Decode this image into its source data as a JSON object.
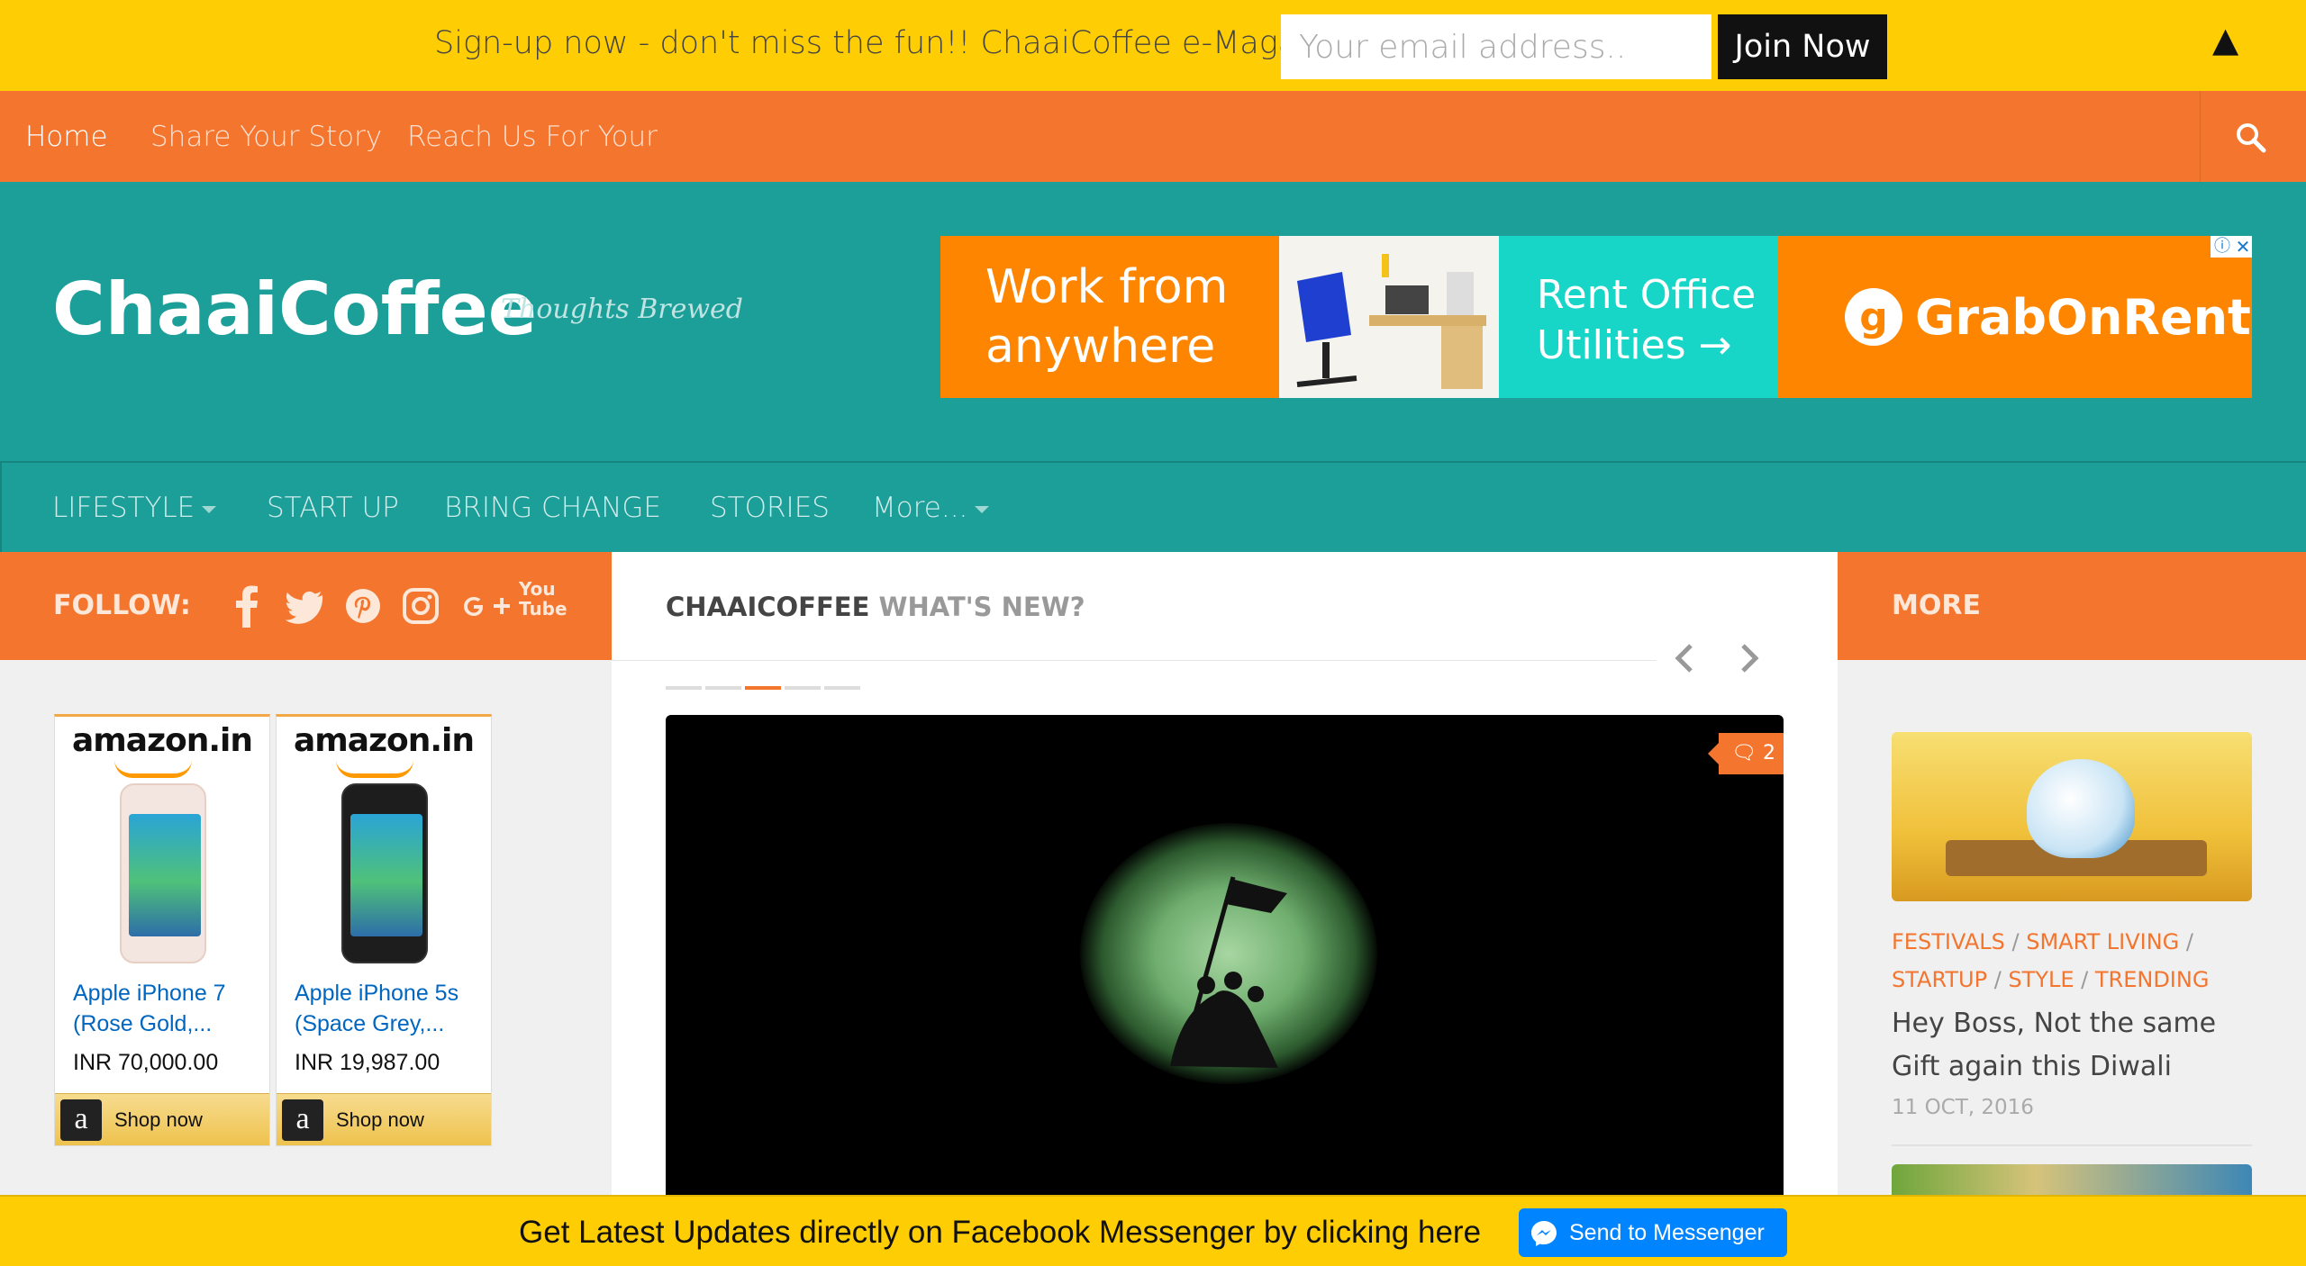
{
  "signup": {
    "text": "Sign-up now - don't miss the fun!! ChaaiCoffee e-Magazine",
    "email_placeholder": "Your email address..",
    "button_label": "Join Now",
    "collapse_glyph": "▲"
  },
  "top_nav": {
    "items": [
      "Home",
      "Share Your Story",
      "Reach Us For Your"
    ],
    "search_icon": "search-icon"
  },
  "header": {
    "site_title": "ChaaiCoffee",
    "tagline": "Thoughts Brewed"
  },
  "ad": {
    "headline": "Work from anywhere",
    "cta": "Rent Office Utilities →",
    "brand": "GrabOnRent",
    "info_glyph": "ⓘ",
    "close_glyph": "✕"
  },
  "category_nav": {
    "items": [
      "LIFESTYLE",
      "START UP",
      "BRING CHANGE",
      "STORIES",
      "More..."
    ]
  },
  "follow": {
    "label": "FOLLOW:",
    "icons": [
      "facebook-icon",
      "twitter-icon",
      "pinterest-icon",
      "instagram-icon",
      "google-plus-icon",
      "youtube-icon"
    ],
    "youtube_text": "You Tube"
  },
  "products": [
    {
      "brand": "amazon.in",
      "title": "Apple iPhone 7 (Rose Gold,...",
      "price": "INR 70,000.00",
      "shop_label": "Shop now"
    },
    {
      "brand": "amazon.in",
      "title": "Apple iPhone 5s (Space Grey,...",
      "price": "INR 19,987.00",
      "shop_label": "Shop now"
    }
  ],
  "main": {
    "title_brand": "CHAAICOFFEE",
    "title_sub": "WHAT'S NEW?",
    "slider_dots": 5,
    "active_dot": 3,
    "comment_count": "2"
  },
  "right": {
    "title": "MORE",
    "post": {
      "tags": [
        "FESTIVALS",
        "SMART LIVING",
        "STARTUP",
        "STYLE",
        "TRENDING"
      ],
      "title": "Hey Boss, Not the same Gift again this Diwali",
      "date": "11 OCT, 2016"
    }
  },
  "messenger": {
    "text": "Get Latest Updates directly on Facebook Messenger by clicking here",
    "button_label": "Send to Messenger"
  },
  "colors": {
    "yellow": "#ffcd04",
    "orange": "#f3752e",
    "teal": "#1c9e99",
    "messenger_blue": "#0084ff"
  }
}
